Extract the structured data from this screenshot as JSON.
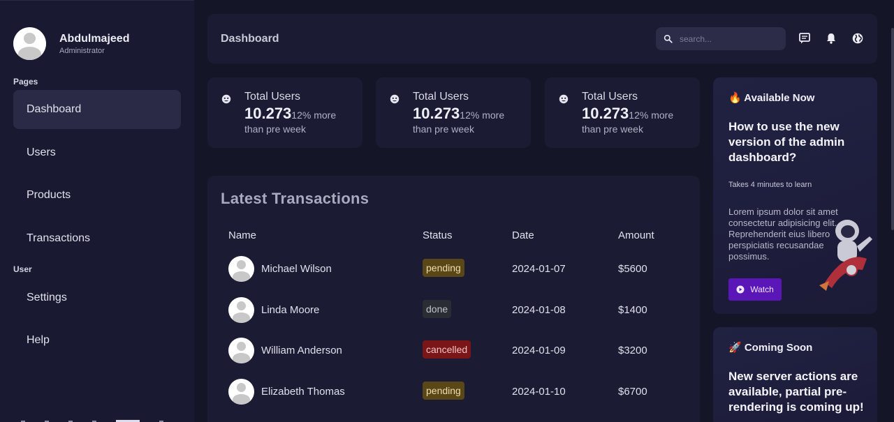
{
  "user": {
    "name": "Abdulmajeed",
    "role": "Administrator"
  },
  "sidebar": {
    "pages_label": "Pages",
    "user_label": "User",
    "items": [
      {
        "label": "Dashboard"
      },
      {
        "label": "Users"
      },
      {
        "label": "Products"
      },
      {
        "label": "Transactions"
      },
      {
        "label": "Settings"
      },
      {
        "label": "Help"
      }
    ]
  },
  "topbar": {
    "title": "Dashboard",
    "search_placeholder": "search...",
    "icons": [
      "message-icon",
      "bell-icon",
      "globe-icon"
    ]
  },
  "stats": [
    {
      "title": "Total Users",
      "value": "10.273",
      "change": "12% more",
      "sub": "than pre week"
    },
    {
      "title": "Total Users",
      "value": "10.273",
      "change": "12% more",
      "sub": "than pre week"
    },
    {
      "title": "Total Users",
      "value": "10.273",
      "change": "12% more",
      "sub": "than pre week"
    }
  ],
  "transactions": {
    "title": "Latest Transactions",
    "columns": [
      "Name",
      "Status",
      "Date",
      "Amount"
    ],
    "rows": [
      {
        "name": "Michael Wilson",
        "status": "pending",
        "date": "2024-01-07",
        "amount": "$5600"
      },
      {
        "name": "Linda Moore",
        "status": "done",
        "date": "2024-01-08",
        "amount": "$1400"
      },
      {
        "name": "William Anderson",
        "status": "cancelled",
        "date": "2024-01-09",
        "amount": "$3200"
      },
      {
        "name": "Elizabeth Thomas",
        "status": "pending",
        "date": "2024-01-10",
        "amount": "$6700"
      }
    ]
  },
  "promo1": {
    "kicker": "🔥 Available Now",
    "headline": "How to use the new version of the admin dashboard?",
    "sub": "Takes 4 minutes to learn",
    "description": "Lorem ipsum dolor sit amet consectetur adipisicing elit. Reprehenderit eius libero perspiciatis recusandae possimus.",
    "button": "Watch"
  },
  "promo2": {
    "kicker": "🚀 Coming Soon",
    "headline": "New server actions are available, partial pre-rendering is coming up!"
  },
  "colors": {
    "background": "#151528",
    "panel": "#1b1b33",
    "sidebar": "#191932",
    "active_nav": "#2a2a47",
    "accent_button": "#5b16b8",
    "pending": "#5a4718",
    "done": "#2a2e34",
    "cancelled": "#7a1518"
  }
}
